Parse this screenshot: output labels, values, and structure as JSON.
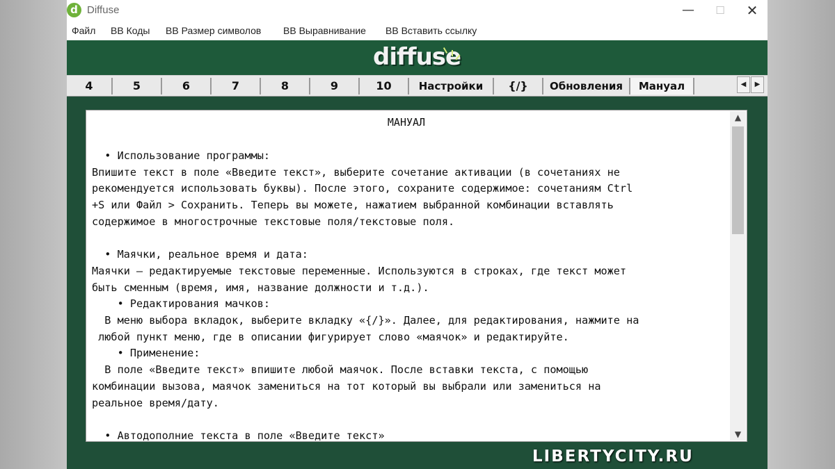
{
  "window": {
    "title": "Diffuse",
    "icon": "diffuse-app-icon"
  },
  "controls": {
    "minimize": "—",
    "maximize": "☐",
    "close": "✕"
  },
  "menu": {
    "file": "Файл",
    "bb_codes": "BB Коды",
    "bb_size": "BB Размер символов",
    "bb_align": "BB Выравнивание",
    "bb_link": "BB Вставить ссылку"
  },
  "brand": {
    "logo_text": "diffuse",
    "color": "#1e5a3a"
  },
  "tabs": [
    "4",
    "5",
    "6",
    "7",
    "8",
    "9",
    "10",
    "Настройки",
    "{/}",
    "Обновления",
    "Мануал"
  ],
  "active_tab": "Мануал",
  "tab_scroll": {
    "left": "◀",
    "right": "▶"
  },
  "manual": {
    "title": "МАНУАЛ",
    "lines": [
      "  • Использование программы:",
      "Впишите текст в поле «Введите текст», выберите сочетание активации (в сочетаниях не",
      "рекомендуется использовать буквы). После этого, сохраните содержимое: сочетаниям Ctrl",
      "+S или Файл > Сохранить. Теперь вы можете, нажатием выбранной комбинации вставлять",
      "содержимое в многострочные текстовые поля/текстовые поля.",
      "",
      "  • Маячки, реальное время и дата:",
      "Маячки — редактируемые текстовые переменные. Используются в строках, где текст может",
      "быть сменным (время, имя, название должности и т.д.).",
      "    • Редактирования мачков:",
      "  В меню выбора вкладок, выберите вкладку «{/}». Далее, для редактирования, нажмите на",
      " любой пункт меню, где в описании фигурирует слово «маячок» и редактируйте.",
      "    • Применение:",
      "  В поле «Введите текст» впишите любой маячок. После вставки текста, с помощью",
      "комбинации вызова, маячок замениться на тот который вы выбрали или замениться на",
      "реальное время/дату.",
      "",
      "  • Автодополние текста в поле «Введите текст»"
    ]
  },
  "scrollbar": {
    "up": "▲",
    "down": "▼"
  },
  "watermark": "LIBERTYCITY.RU"
}
